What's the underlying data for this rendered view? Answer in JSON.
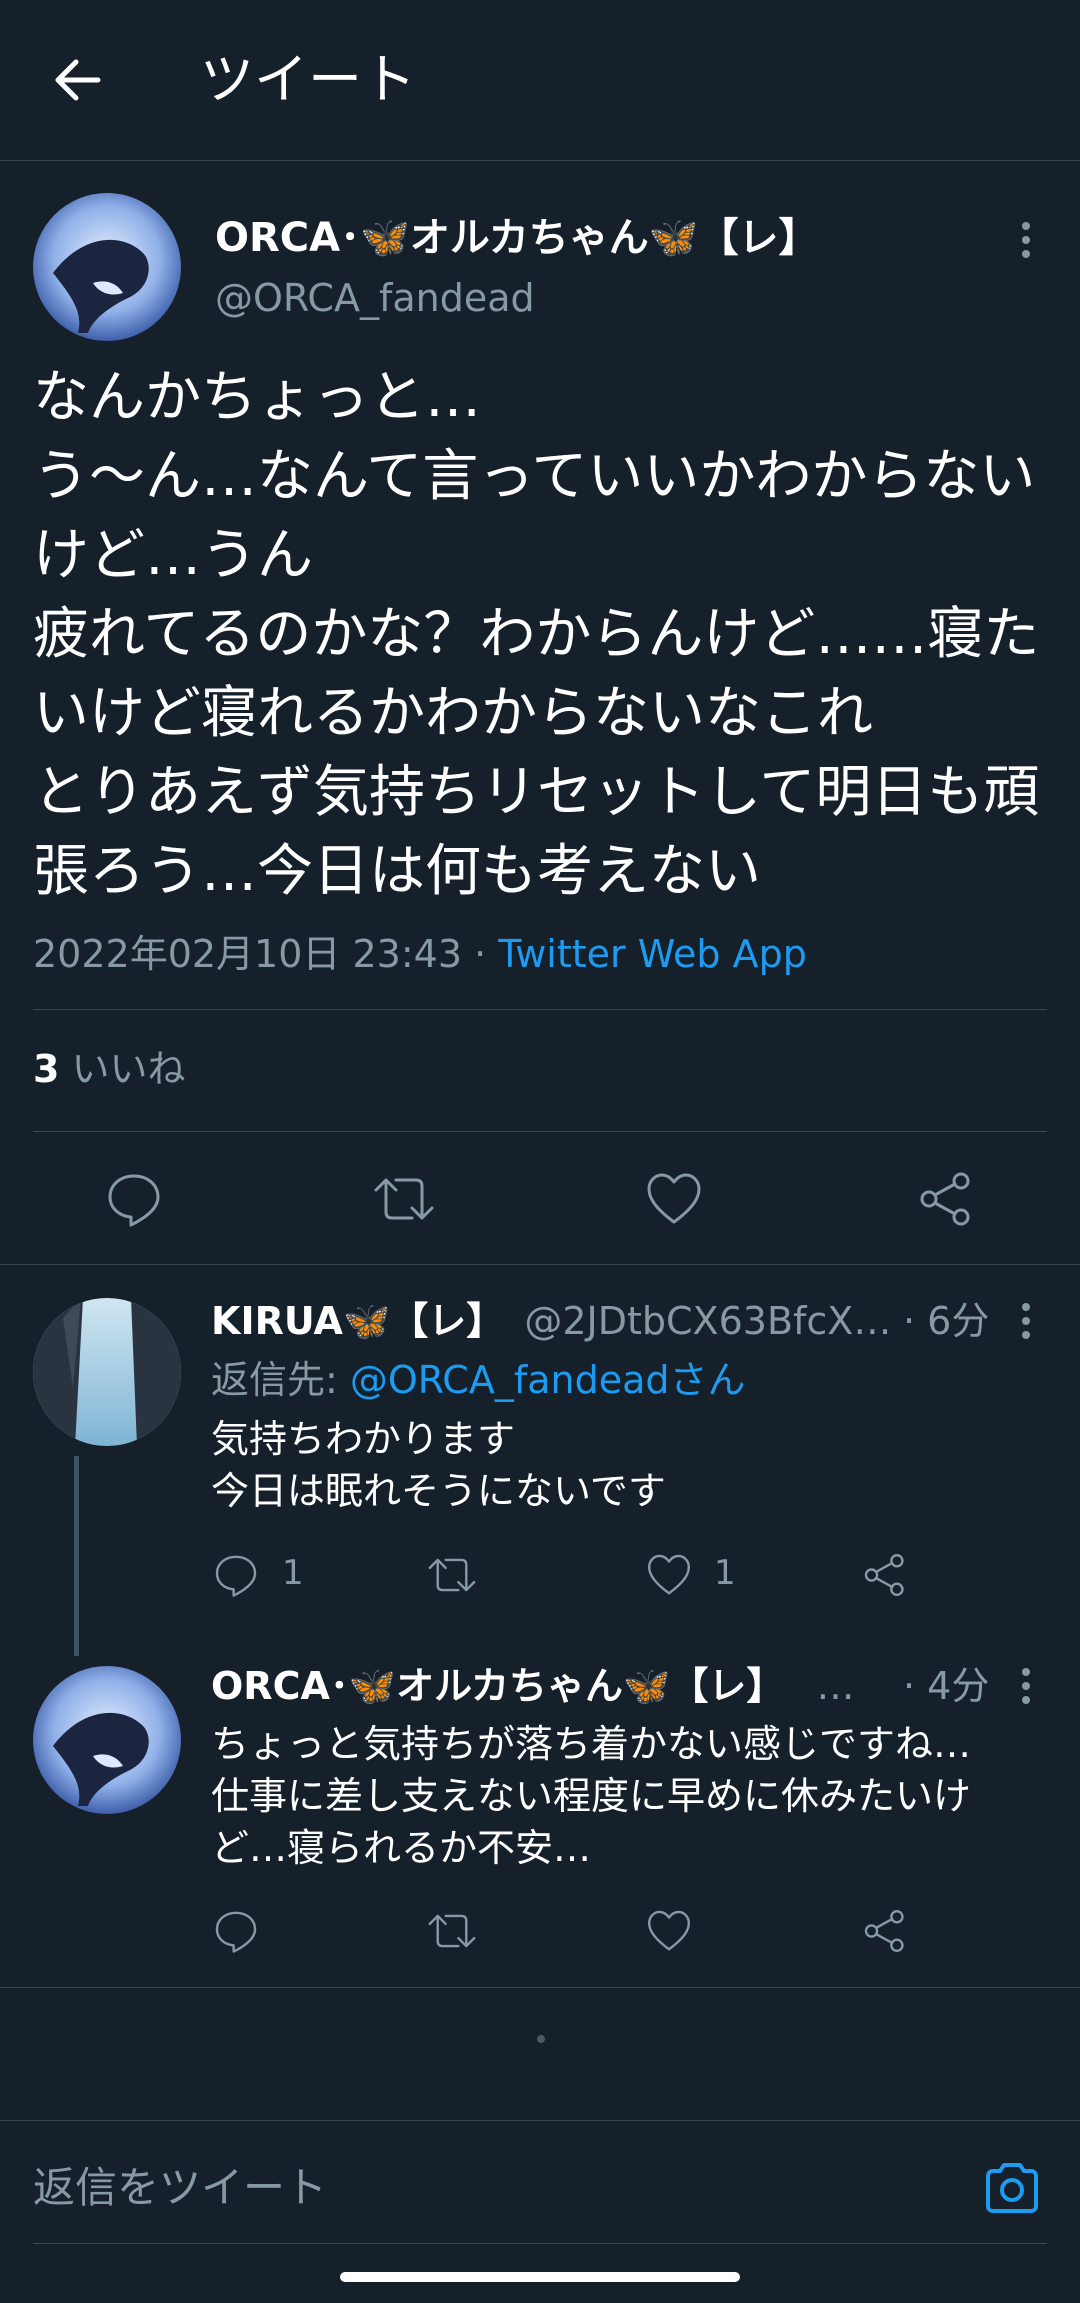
{
  "header": {
    "title": "ツイート",
    "back_icon": "arrow-left-icon"
  },
  "main_tweet": {
    "display_name": "ORCA･🦋オルカちゃん🦋【レ】",
    "handle": "@ORCA_fandead",
    "text": "なんかちょっと…\nう〜ん…なんて言っていいかわからないけど…うん\n疲れてるのかな？わからんけど……寝たいけど寝れるかわからないなこれ\nとりあえず気持ちリセットして明日も頑張ろう…今日は何も考えない",
    "timestamp": "2022年02月10日 23:43",
    "separator": " · ",
    "source": "Twitter Web App",
    "likes_count": "3",
    "likes_label": "いいね"
  },
  "replies": [
    {
      "display_name": "KIRUA🦋【レ】",
      "handle": "@2JDtbCX63BfcX…",
      "time": "· 6分",
      "reply_to_label": "返信先: ",
      "reply_to_handle": "@ORCA_fandeadさん",
      "text": "気持ちわかります\n今日は眠れそうにないです",
      "reply_count": "1",
      "retweet_count": "",
      "like_count": "1"
    },
    {
      "display_name": "ORCA･🦋オルカちゃん🦋【レ】",
      "handle": "…",
      "time": "· 4分",
      "text": "ちょっと気持ちが落ち着かない感じですね…\n仕事に差し支えない程度に早めに休みたいけど…寝られるか不安…",
      "reply_count": "",
      "retweet_count": "",
      "like_count": ""
    }
  ],
  "composer": {
    "placeholder": "返信をツイート",
    "camera_icon": "camera-icon"
  },
  "colors": {
    "background": "#15202b",
    "accent": "#1d9bf0",
    "muted": "#8899a6",
    "divider": "#38444d"
  }
}
